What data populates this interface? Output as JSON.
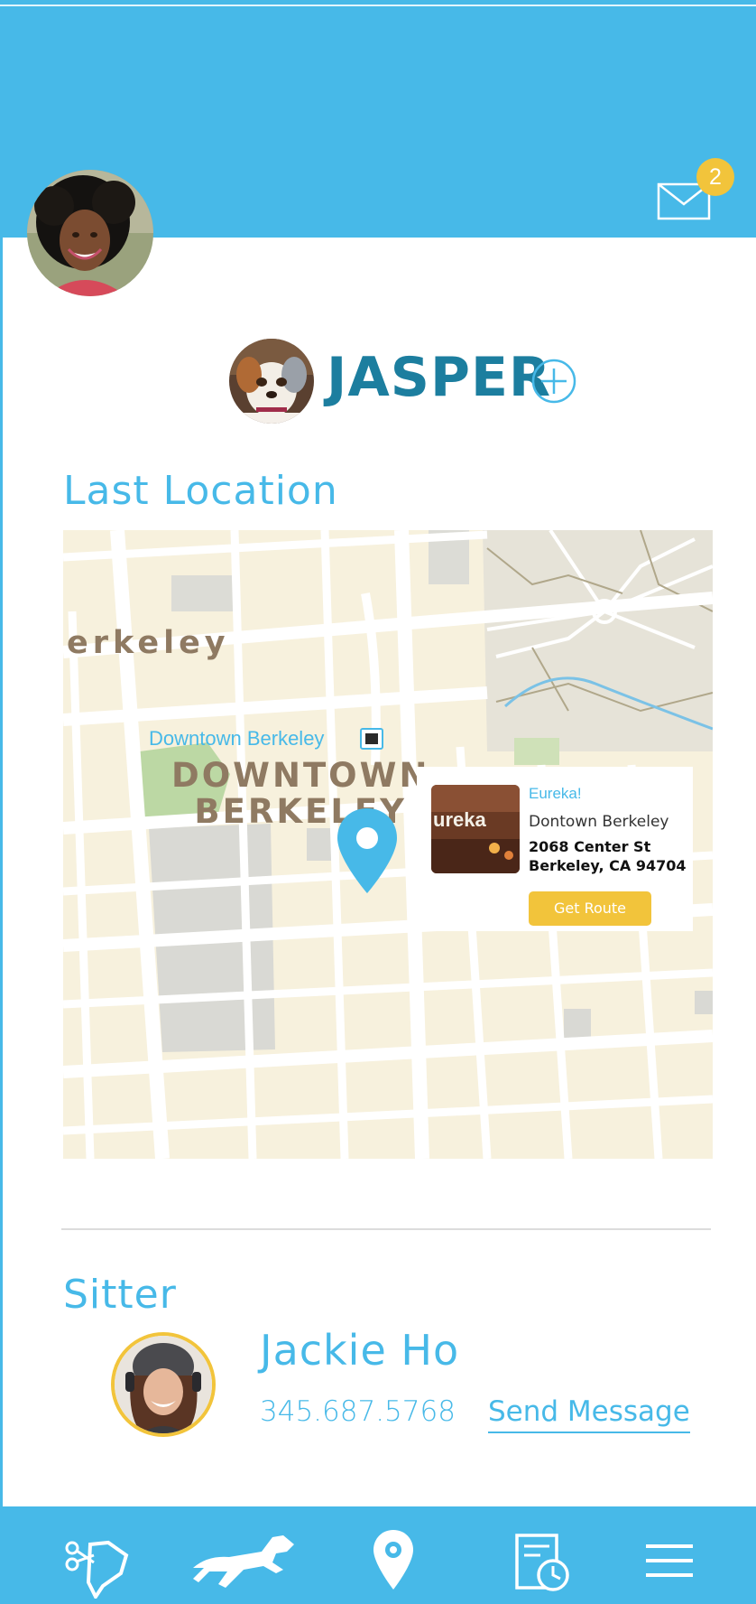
{
  "header": {
    "unread_count": "2",
    "mail_icon": "envelope-icon",
    "colors": {
      "brand": "#47b9e8",
      "accent": "#f2c43b",
      "title_dark": "#1c7e9f"
    }
  },
  "pet": {
    "name": "JASPER",
    "add_icon": "plus-circle-icon"
  },
  "last_location": {
    "title": "Last Location",
    "map": {
      "area_label": "erkeley",
      "station_label": "Downtown Berkeley",
      "downtown_line1": "DOWNTOWN",
      "downtown_line2": "BERKELEY"
    },
    "place": {
      "name": "Eureka!",
      "area": "Dontown Berkeley",
      "address_line1": "2068 Center St",
      "address_line2": "Berkeley, CA 94704",
      "image_text": "ureka",
      "route_button": "Get Route"
    }
  },
  "sitter": {
    "title": "Sitter",
    "name": "Jackie Ho",
    "phone": "345.687.5768",
    "message_link": "Send Message"
  },
  "bottom_nav": [
    {
      "icon": "dog-groom-icon"
    },
    {
      "icon": "running-dog-icon"
    },
    {
      "icon": "location-pin-icon"
    },
    {
      "icon": "schedule-icon"
    },
    {
      "icon": "menu-icon"
    }
  ]
}
